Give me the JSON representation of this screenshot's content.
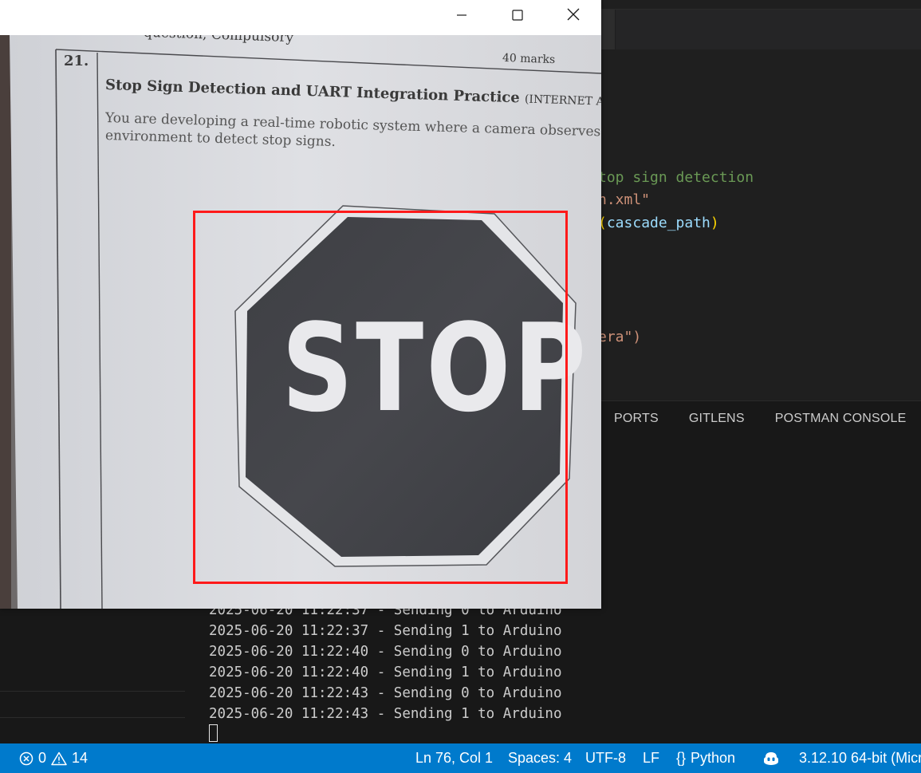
{
  "camera_window": {
    "controls": {
      "minimize": "minimize-icon",
      "maximize": "maximize-icon",
      "close": "close-icon"
    },
    "paper": {
      "header_text": "question, Compulsory",
      "question_number": "21.",
      "marks": "40 marks",
      "title": "Stop Sign Detection and UART Integration Practice",
      "title_suffix": "(INTERNET A",
      "body_line1": "You are developing a real-time robotic system where a camera observes t",
      "body_line2": "environment to detect stop signs."
    },
    "sign_text": "STOP",
    "detection_color": "#ff1a1a"
  },
  "editor": {
    "code_lines": [
      {
        "text": "top sign detection",
        "kind": "comment"
      },
      {
        "text": "n.xml\"",
        "kind": "string"
      },
      {
        "pre": "(",
        "ident": "cascade_path",
        "post": ")"
      },
      {
        "text": "era\")",
        "kind": "string_paren"
      }
    ]
  },
  "panel": {
    "tabs": [
      "PORTS",
      "GITLENS",
      "POSTMAN CONSOLE"
    ]
  },
  "terminal": {
    "lines": [
      "2025-06-20 11:22:37 - Sending 0 to Arduino",
      "2025-06-20 11:22:37 - Sending 1 to Arduino",
      "2025-06-20 11:22:40 - Sending 0 to Arduino",
      "2025-06-20 11:22:40 - Sending 1 to Arduino",
      "2025-06-20 11:22:43 - Sending 0 to Arduino",
      "2025-06-20 11:22:43 - Sending 1 to Arduino"
    ]
  },
  "statusbar": {
    "errors": "0",
    "warnings": "14",
    "position": "Ln 76, Col 1",
    "spaces": "Spaces: 4",
    "encoding": "UTF-8",
    "eol": "LF",
    "language": "Python",
    "language_icon": "{}",
    "interpreter": "3.12.10 64-bit (Micr",
    "color": "#007acc"
  }
}
